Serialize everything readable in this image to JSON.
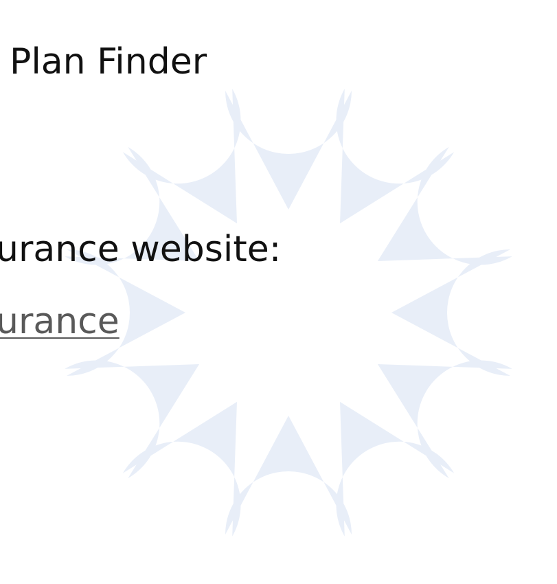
{
  "slide": {
    "title": "Plan Finder",
    "body_text": "urance website:",
    "link_text": "urance"
  },
  "watermark": {
    "icon": "flower-petal-logo",
    "color": "#e8eef8"
  }
}
